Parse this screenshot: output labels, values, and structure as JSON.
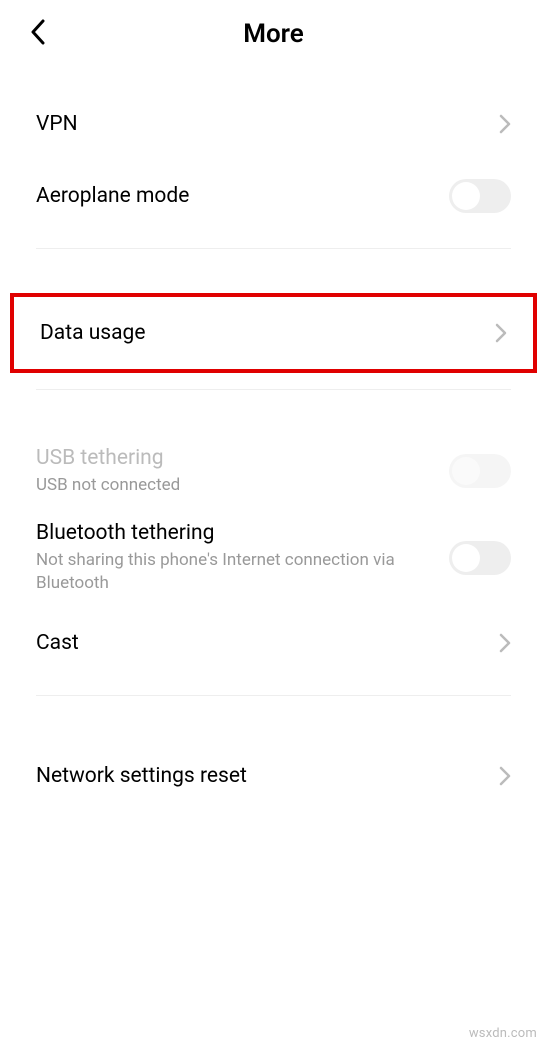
{
  "header": {
    "title": "More"
  },
  "rows": {
    "vpn": {
      "title": "VPN"
    },
    "aeroplane": {
      "title": "Aeroplane mode"
    },
    "data_usage": {
      "title": "Data usage"
    },
    "usb_tethering": {
      "title": "USB tethering",
      "subtitle": "USB not connected"
    },
    "bt_tethering": {
      "title": "Bluetooth tethering",
      "subtitle": "Not sharing this phone's Internet connection via Bluetooth"
    },
    "cast": {
      "title": "Cast"
    },
    "net_reset": {
      "title": "Network settings reset"
    }
  },
  "watermark": "wsxdn.com"
}
